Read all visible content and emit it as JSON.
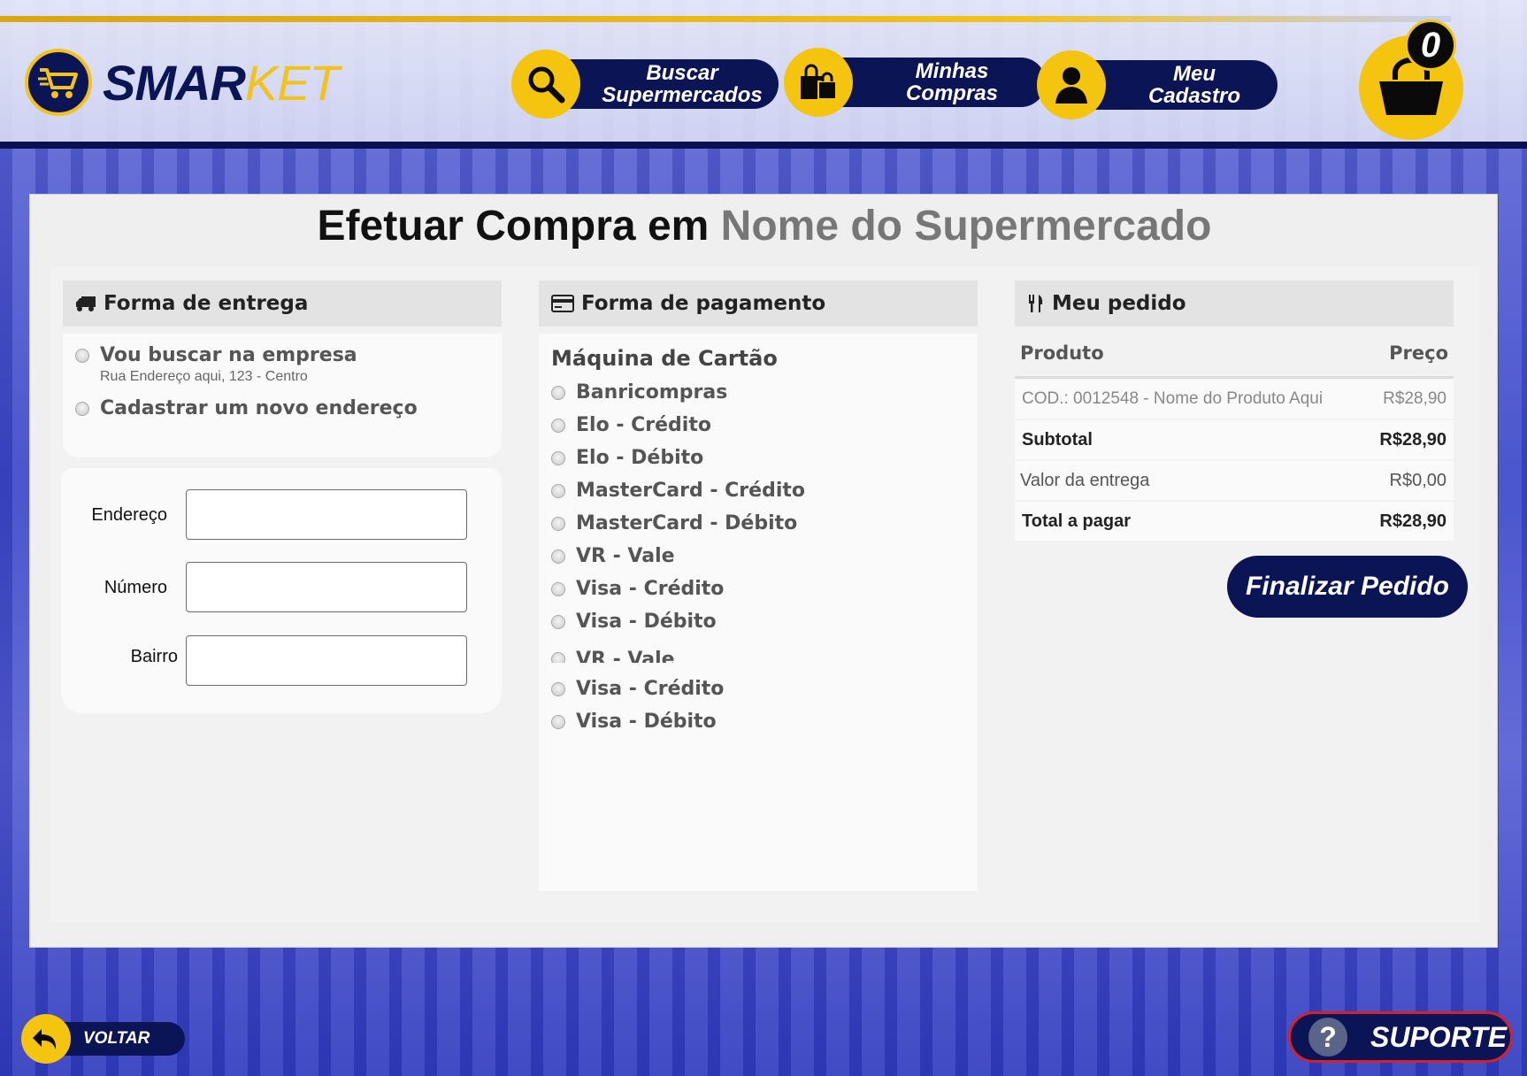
{
  "header": {
    "logo_main": "SMAR",
    "logo_accent": "KET",
    "nav": [
      {
        "label": "Buscar\nSupermercados",
        "icon": "search-icon"
      },
      {
        "label": "Minhas\nCompras",
        "icon": "shopping-bags-icon"
      },
      {
        "label": "Meu\nCadastro",
        "icon": "user-icon"
      }
    ],
    "cart_count": "0"
  },
  "page": {
    "title_prefix": "Efetuar Compra em",
    "store_name": "Nome do Supermercado"
  },
  "delivery": {
    "heading": "Forma de entrega",
    "option_pickup": "Vou buscar na empresa",
    "pickup_address": "Rua Endereço aqui, 123 - Centro",
    "option_new": "Cadastrar um novo endereço",
    "fields": {
      "address_label": "Endereço",
      "number_label": "Número",
      "district_label": "Bairro"
    }
  },
  "payment": {
    "heading": "Forma de pagamento",
    "group_title": "Máquina de Cartão",
    "options": [
      "Banricompras",
      "Elo - Crédito",
      "Elo - Débito",
      "MasterCard - Crédito",
      "MasterCard - Débito",
      "VR - Vale",
      "Visa - Crédito",
      "Visa - Débito",
      "VR - Vale",
      "Visa - Crédito",
      "Visa - Débito"
    ]
  },
  "order": {
    "heading": "Meu pedido",
    "col_product": "Produto",
    "col_price": "Preço",
    "item_name": "COD.: 0012548 - Nome do Produto Aqui",
    "item_price": "R$28,90",
    "subtotal_label": "Subtotal",
    "subtotal_value": "R$28,90",
    "delivery_label": "Valor da entrega",
    "delivery_value": "R$0,00",
    "total_label": "Total a pagar",
    "total_value": "R$28,90",
    "finalize_label": "Finalizar Pedido"
  },
  "footer": {
    "back_label": "VOLTAR",
    "support_label": "SUPORTE",
    "support_icon_glyph": "?"
  },
  "colors": {
    "navy": "#0b1455",
    "gold": "#f4c40f",
    "support_border": "#d6202a"
  }
}
